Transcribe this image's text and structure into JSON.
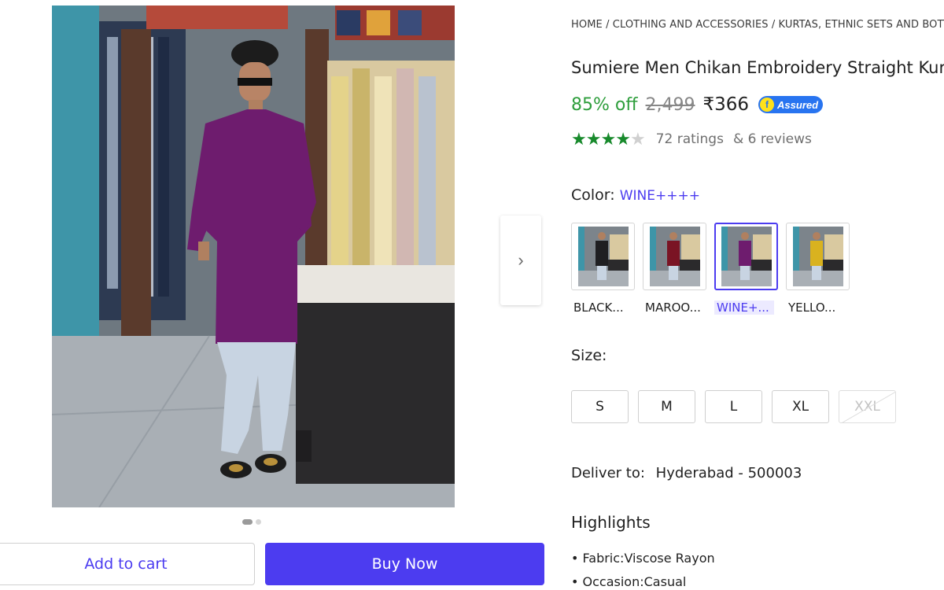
{
  "gallery": {
    "next_arrow_icon": "chevron-right-icon",
    "next_arrow_glyph": "›",
    "dots_total": 2,
    "dots_active_index": 0
  },
  "actions": {
    "add_to_cart": "Add to cart",
    "buy_now": "Buy Now"
  },
  "product": {
    "breadcrumb": "HOME / CLOTHING AND ACCESSORIES / KURTAS, ETHNIC SETS AND BOTTOMS",
    "title": "Sumiere Men Chikan Embroidery Straight Kurta",
    "discount": "85% off",
    "mrp": "2,499",
    "price": "₹366",
    "assured_badge": "Assured",
    "assured_icon": "f",
    "rating_value": 4,
    "rating_max": 5,
    "ratings_text": "72 ratings",
    "reviews_text": "& 6 reviews"
  },
  "color": {
    "label": "Color:",
    "selected_value": "WINE++++",
    "options": [
      {
        "label": "BLACK...",
        "kurta_color": "#1f1f22",
        "selected": false
      },
      {
        "label": "MAROO...",
        "kurta_color": "#7a1424",
        "selected": false
      },
      {
        "label": "WINE+...",
        "kurta_color": "#6e1c6e",
        "selected": true
      },
      {
        "label": "YELLO...",
        "kurta_color": "#d9b21f",
        "selected": false
      }
    ]
  },
  "size": {
    "label": "Size:",
    "options": [
      {
        "label": "S",
        "available": true
      },
      {
        "label": "M",
        "available": true
      },
      {
        "label": "L",
        "available": true
      },
      {
        "label": "XL",
        "available": true
      },
      {
        "label": "XXL",
        "available": false
      }
    ]
  },
  "delivery": {
    "label": "Deliver to:",
    "location": "Hyderabad - 500003"
  },
  "highlights": {
    "title": "Highlights",
    "items": [
      "Fabric:Viscose Rayon",
      "Occasion:Casual"
    ]
  },
  "colors": {
    "accent": "#4c3cf0",
    "discount_green": "#2e9e3c",
    "star_green": "#188a2c",
    "assured_blue": "#2874f0"
  }
}
